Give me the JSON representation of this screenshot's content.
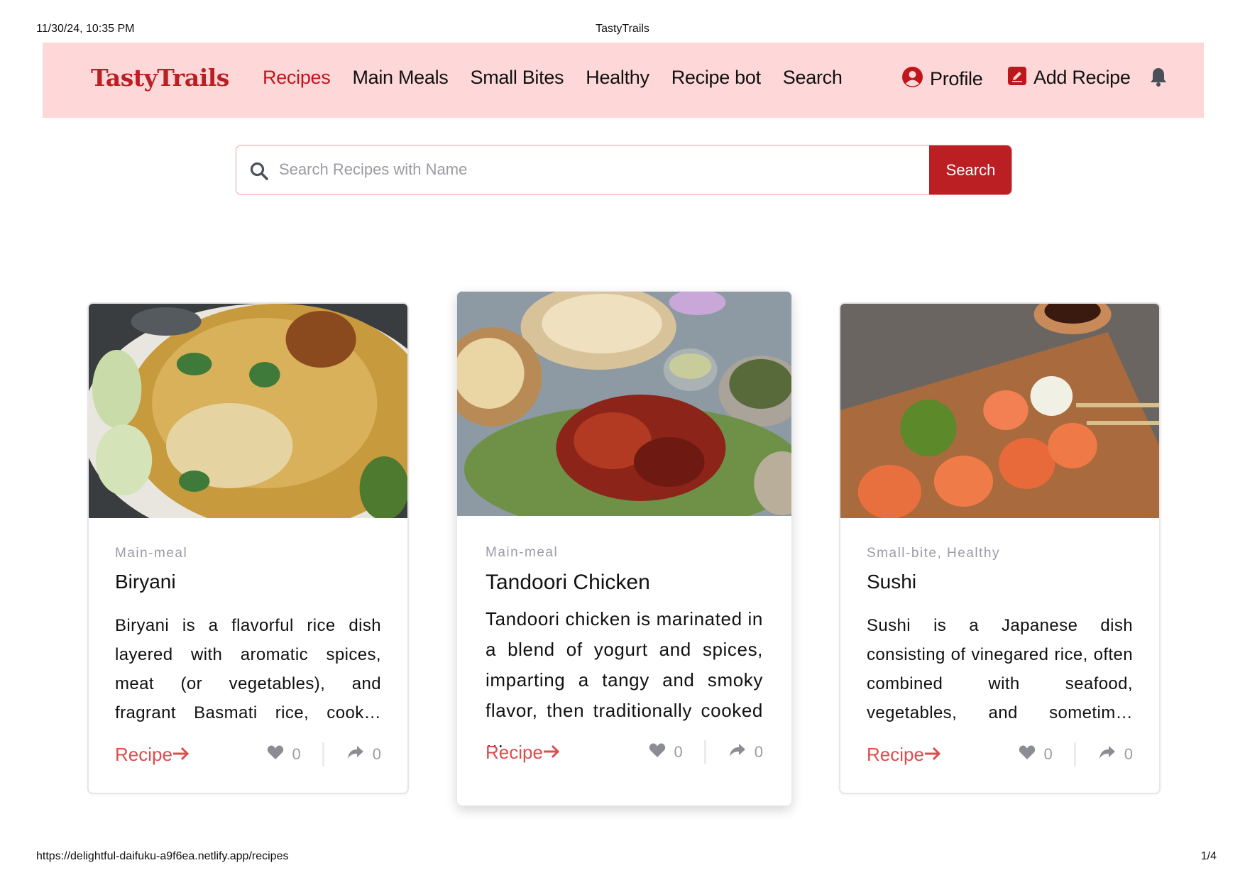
{
  "print_header": {
    "date": "11/30/24, 10:35 PM",
    "title": "TastyTrails"
  },
  "print_footer": {
    "url": "https://delightful-daifuku-a9f6ea.netlify.app/recipes",
    "page": "1/4"
  },
  "nav": {
    "brand": "TastyTrails",
    "links": [
      {
        "label": "Recipes",
        "active": true
      },
      {
        "label": "Main Meals"
      },
      {
        "label": "Small Bites"
      },
      {
        "label": "Healthy"
      },
      {
        "label": "Recipe bot"
      },
      {
        "label": "Search"
      }
    ],
    "profile_label": "Profile",
    "add_recipe_label": "Add Recipe",
    "icons": [
      "user-circle-icon",
      "edit-square-icon",
      "bell-icon"
    ]
  },
  "search": {
    "placeholder": "Search Recipes with Name",
    "value": "",
    "button_label": "Search"
  },
  "cards": [
    {
      "category": "Main-meal",
      "title": "Biryani",
      "description": "Biryani is a flavorful rice dish layered with aromatic spices, meat (or vegetables), and fragrant Basmati rice, cook…",
      "link_label": "Recipe",
      "likes": "0",
      "shares": "0"
    },
    {
      "category": "Main-meal",
      "title": "Tandoori Chicken",
      "description": "Tandoori chicken is marinated in a blend of yogurt and spices, imparting a tangy and smoky flavor, then traditionally cooked …",
      "link_label": "Recipe",
      "likes": "0",
      "shares": "0"
    },
    {
      "category": "Small-bite, Healthy",
      "title": "Sushi",
      "description": "Sushi is a Japanese dish consisting of vinegared rice, often combined with seafood, vegetables, and sometim…",
      "link_label": "Recipe",
      "likes": "0",
      "shares": "0"
    }
  ],
  "colors": {
    "brand": "#bb1e23",
    "nav_bg": "#fed7d8",
    "link": "#dd4d4d",
    "muted": "#9b9ba5"
  }
}
